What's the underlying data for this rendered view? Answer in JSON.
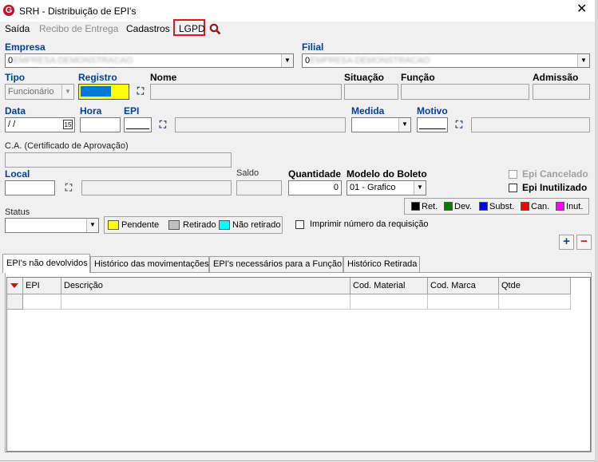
{
  "window": {
    "title": "SRH - Distribuição de EPI's",
    "app_icon": "G",
    "close": "✕"
  },
  "menu": {
    "saida": "Saída",
    "recibo": "Recibo de Entrega",
    "cadastros": "Cadastros",
    "lgpd": "LGPD"
  },
  "labels": {
    "empresa": "Empresa",
    "filial": "Filial",
    "tipo": "Tipo",
    "registro": "Registro",
    "nome": "Nome",
    "situacao": "Situação",
    "funcao": "Função",
    "admissao": "Admissão",
    "data": "Data",
    "hora": "Hora",
    "epi": "EPI",
    "medida": "Medida",
    "motivo": "Motivo",
    "ca": "C.A. (Certificado de Aprovação)",
    "local": "Local",
    "saldo": "Saldo",
    "quantidade": "Quantidade",
    "modelo_boleto": "Modelo do Boleto",
    "epi_cancelado": "Epi Cancelado",
    "epi_inutilizado": "Epi Inutilizado",
    "status": "Status",
    "imprimir": "Imprimir número da requisição"
  },
  "fields": {
    "empresa_value": "0",
    "empresa_blurred": "EMPRESA DEMONSTRACAO",
    "filial_value": "0",
    "filial_blurred": "EMPRESA DEMONSTRACAO",
    "tipo_value": "Funcionário",
    "data_value": " /  /",
    "data_icon": "15",
    "quantidade_value": "0",
    "modelo_boleto_value": "01 - Grafico"
  },
  "legend": [
    {
      "label": "Ret.",
      "color": "#000000"
    },
    {
      "label": "Dev.",
      "color": "#008000"
    },
    {
      "label": "Subst.",
      "color": "#0000ff"
    },
    {
      "label": "Can.",
      "color": "#ff0000"
    },
    {
      "label": "Inut.",
      "color": "#ff00ff"
    }
  ],
  "status_legend": [
    {
      "label": "Pendente",
      "color": "#ffff00"
    },
    {
      "label": "Retirado",
      "color": "#c0c0c0"
    },
    {
      "label": "Não retirado",
      "color": "#00ffff"
    }
  ],
  "buttons": {
    "add": "+",
    "remove": "−"
  },
  "tabs": [
    {
      "label": "EPI's não devolvidos",
      "active": true
    },
    {
      "label": "Histórico das movimentações"
    },
    {
      "label": "EPI's necessários para a Função"
    },
    {
      "label": "Histórico Retirada"
    }
  ],
  "grid": {
    "columns": [
      "EPI",
      "Descrição",
      "Cod. Material",
      "Cod. Marca",
      "Qtde"
    ]
  },
  "colors": {
    "accent_blue": "#003ea0",
    "highlight_red": "#e8141c",
    "registro_yellow": "#ffff00"
  }
}
